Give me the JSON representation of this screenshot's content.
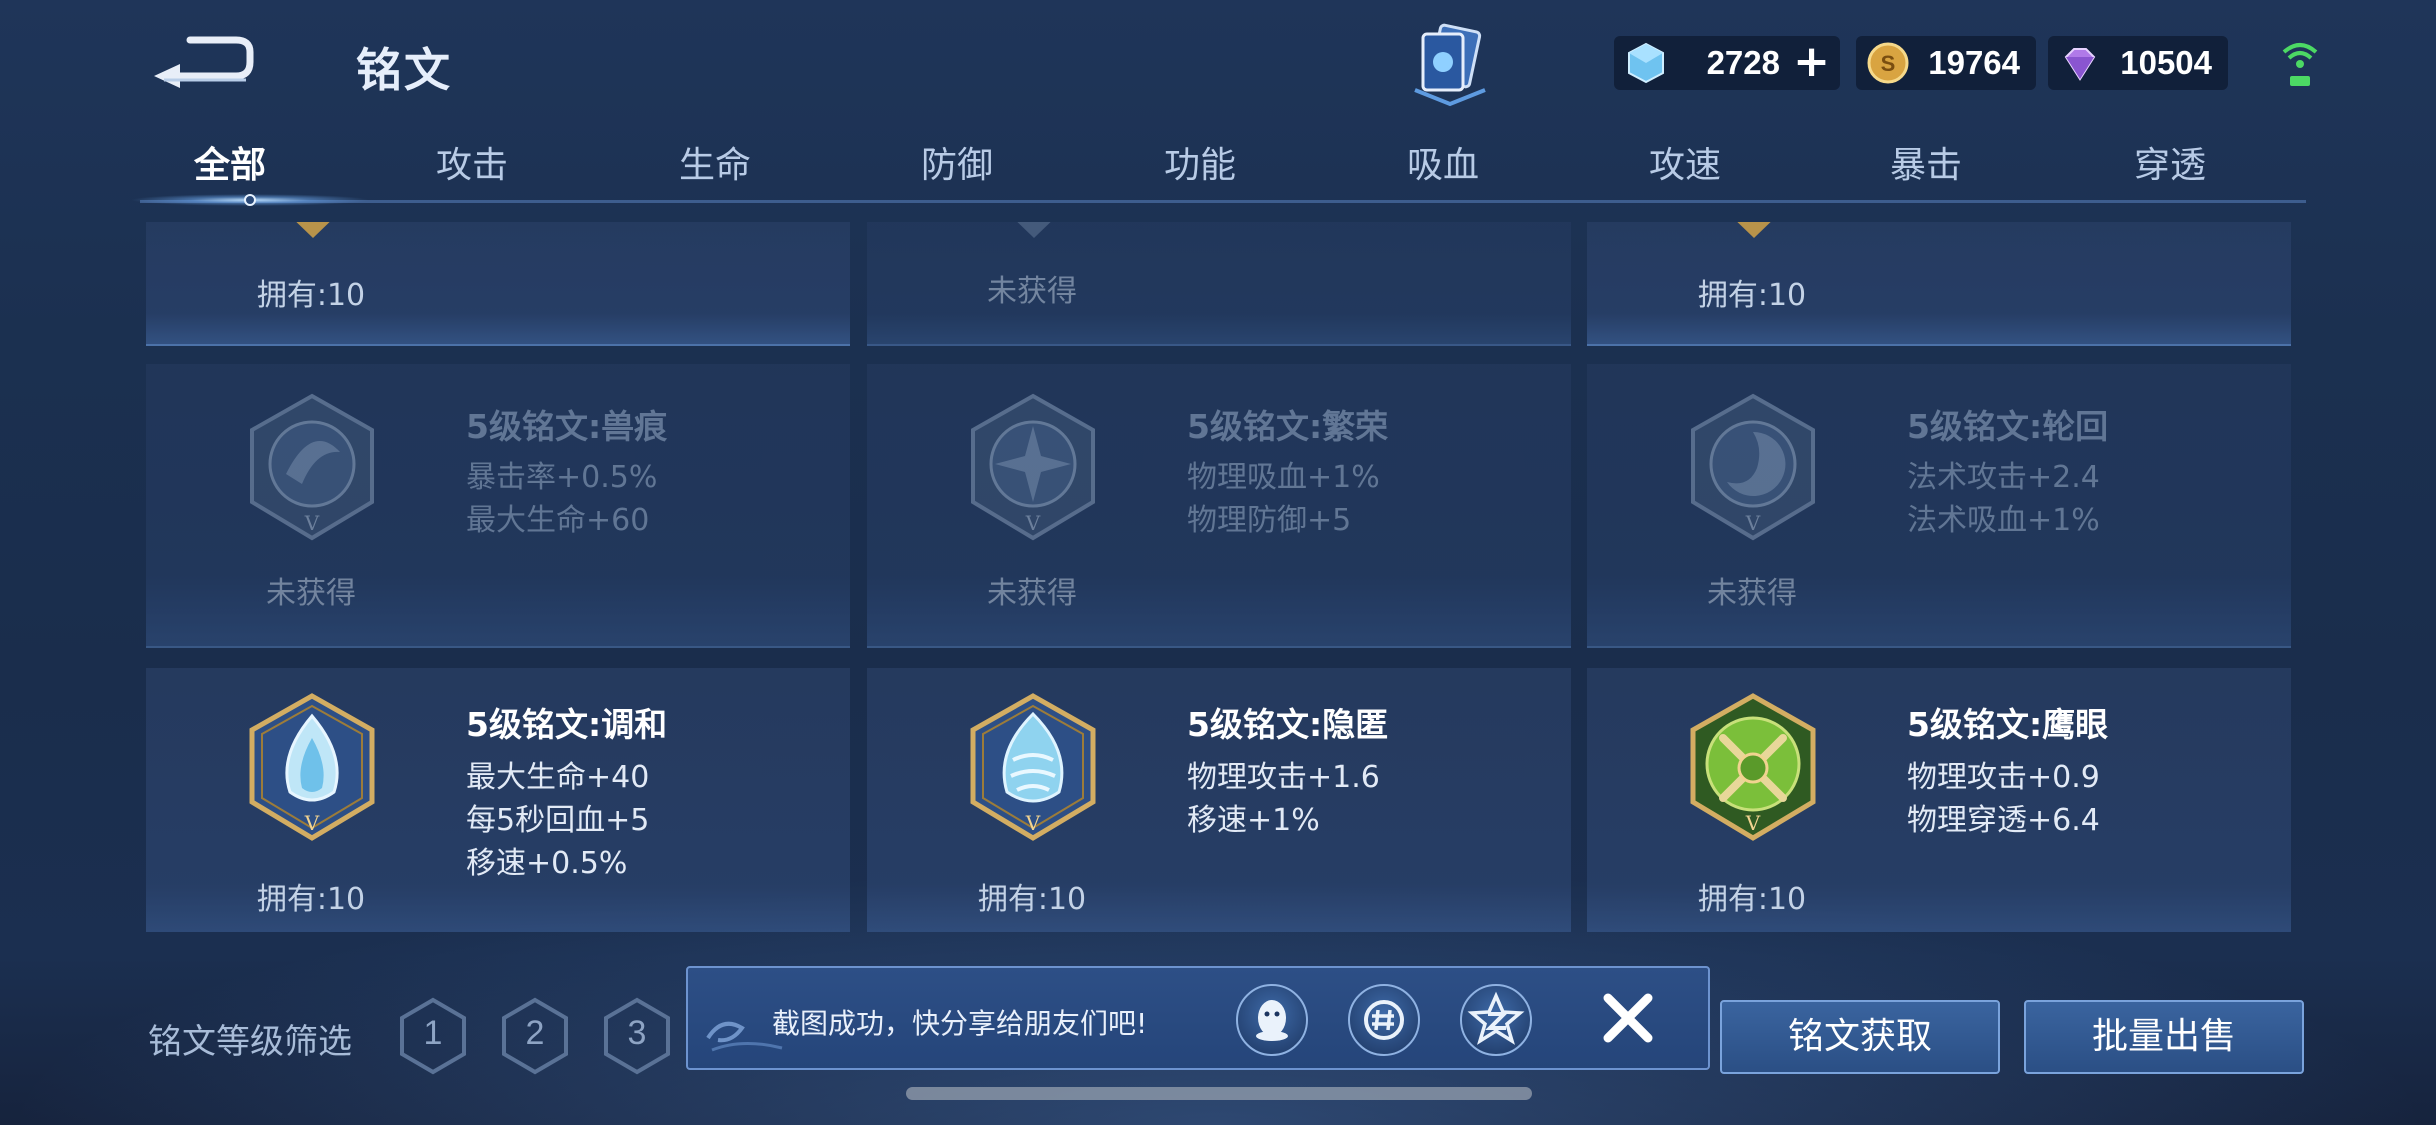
{
  "header": {
    "title": "铭文",
    "back_icon": "back-arrow-icon",
    "currencies": [
      {
        "name": "gem",
        "icon": "crystal-icon",
        "value": "2728"
      },
      {
        "name": "coin",
        "icon": "gold-coin-icon",
        "value": "19764"
      },
      {
        "name": "diamond",
        "icon": "purple-diamond-icon",
        "value": "10504"
      }
    ]
  },
  "tabs": [
    {
      "label": "全部",
      "active": true
    },
    {
      "label": "攻击"
    },
    {
      "label": "生命"
    },
    {
      "label": "防御"
    },
    {
      "label": "功能"
    },
    {
      "label": "吸血"
    },
    {
      "label": "攻速"
    },
    {
      "label": "暴击"
    },
    {
      "label": "穿透"
    }
  ],
  "runes": {
    "row0": [
      {
        "owned": "拥有:10"
      },
      {
        "owned": "未获得"
      },
      {
        "owned": "拥有:10"
      }
    ],
    "row1": [
      {
        "name": "5级铭文:兽痕",
        "stats": [
          "暴击率+0.5%",
          "最大生命+60"
        ],
        "owned": "未获得"
      },
      {
        "name": "5级铭文:繁荣",
        "stats": [
          "物理吸血+1%",
          "物理防御+5"
        ],
        "owned": "未获得"
      },
      {
        "name": "5级铭文:轮回",
        "stats": [
          "法术攻击+2.4",
          "法术吸血+1%"
        ],
        "owned": "未获得"
      }
    ],
    "row2": [
      {
        "name": "5级铭文:调和",
        "stats": [
          "最大生命+40",
          "每5秒回血+5",
          "移速+0.5%"
        ],
        "owned": "拥有:10"
      },
      {
        "name": "5级铭文:隐匿",
        "stats": [
          "物理攻击+1.6",
          "移速+1%"
        ],
        "owned": "拥有:10"
      },
      {
        "name": "5级铭文:鹰眼",
        "stats": [
          "物理攻击+0.9",
          "物理穿透+6.4"
        ],
        "owned": "拥有:10"
      }
    ]
  },
  "footer": {
    "filter_label": "铭文等级筛选",
    "levels": [
      "1",
      "2",
      "3"
    ],
    "toast_message": "截图成功，快分享给朋友们吧!",
    "share_icons": [
      "qq-icon",
      "wechat-moments-icon",
      "qzone-icon"
    ],
    "btn_get": "铭文获取",
    "btn_sell": "批量出售"
  },
  "colors": {
    "accent": "#7aa3dc",
    "background": "#1b3050",
    "green_rune": "#7bbf3a",
    "gold_frame": "#c9a45a"
  }
}
